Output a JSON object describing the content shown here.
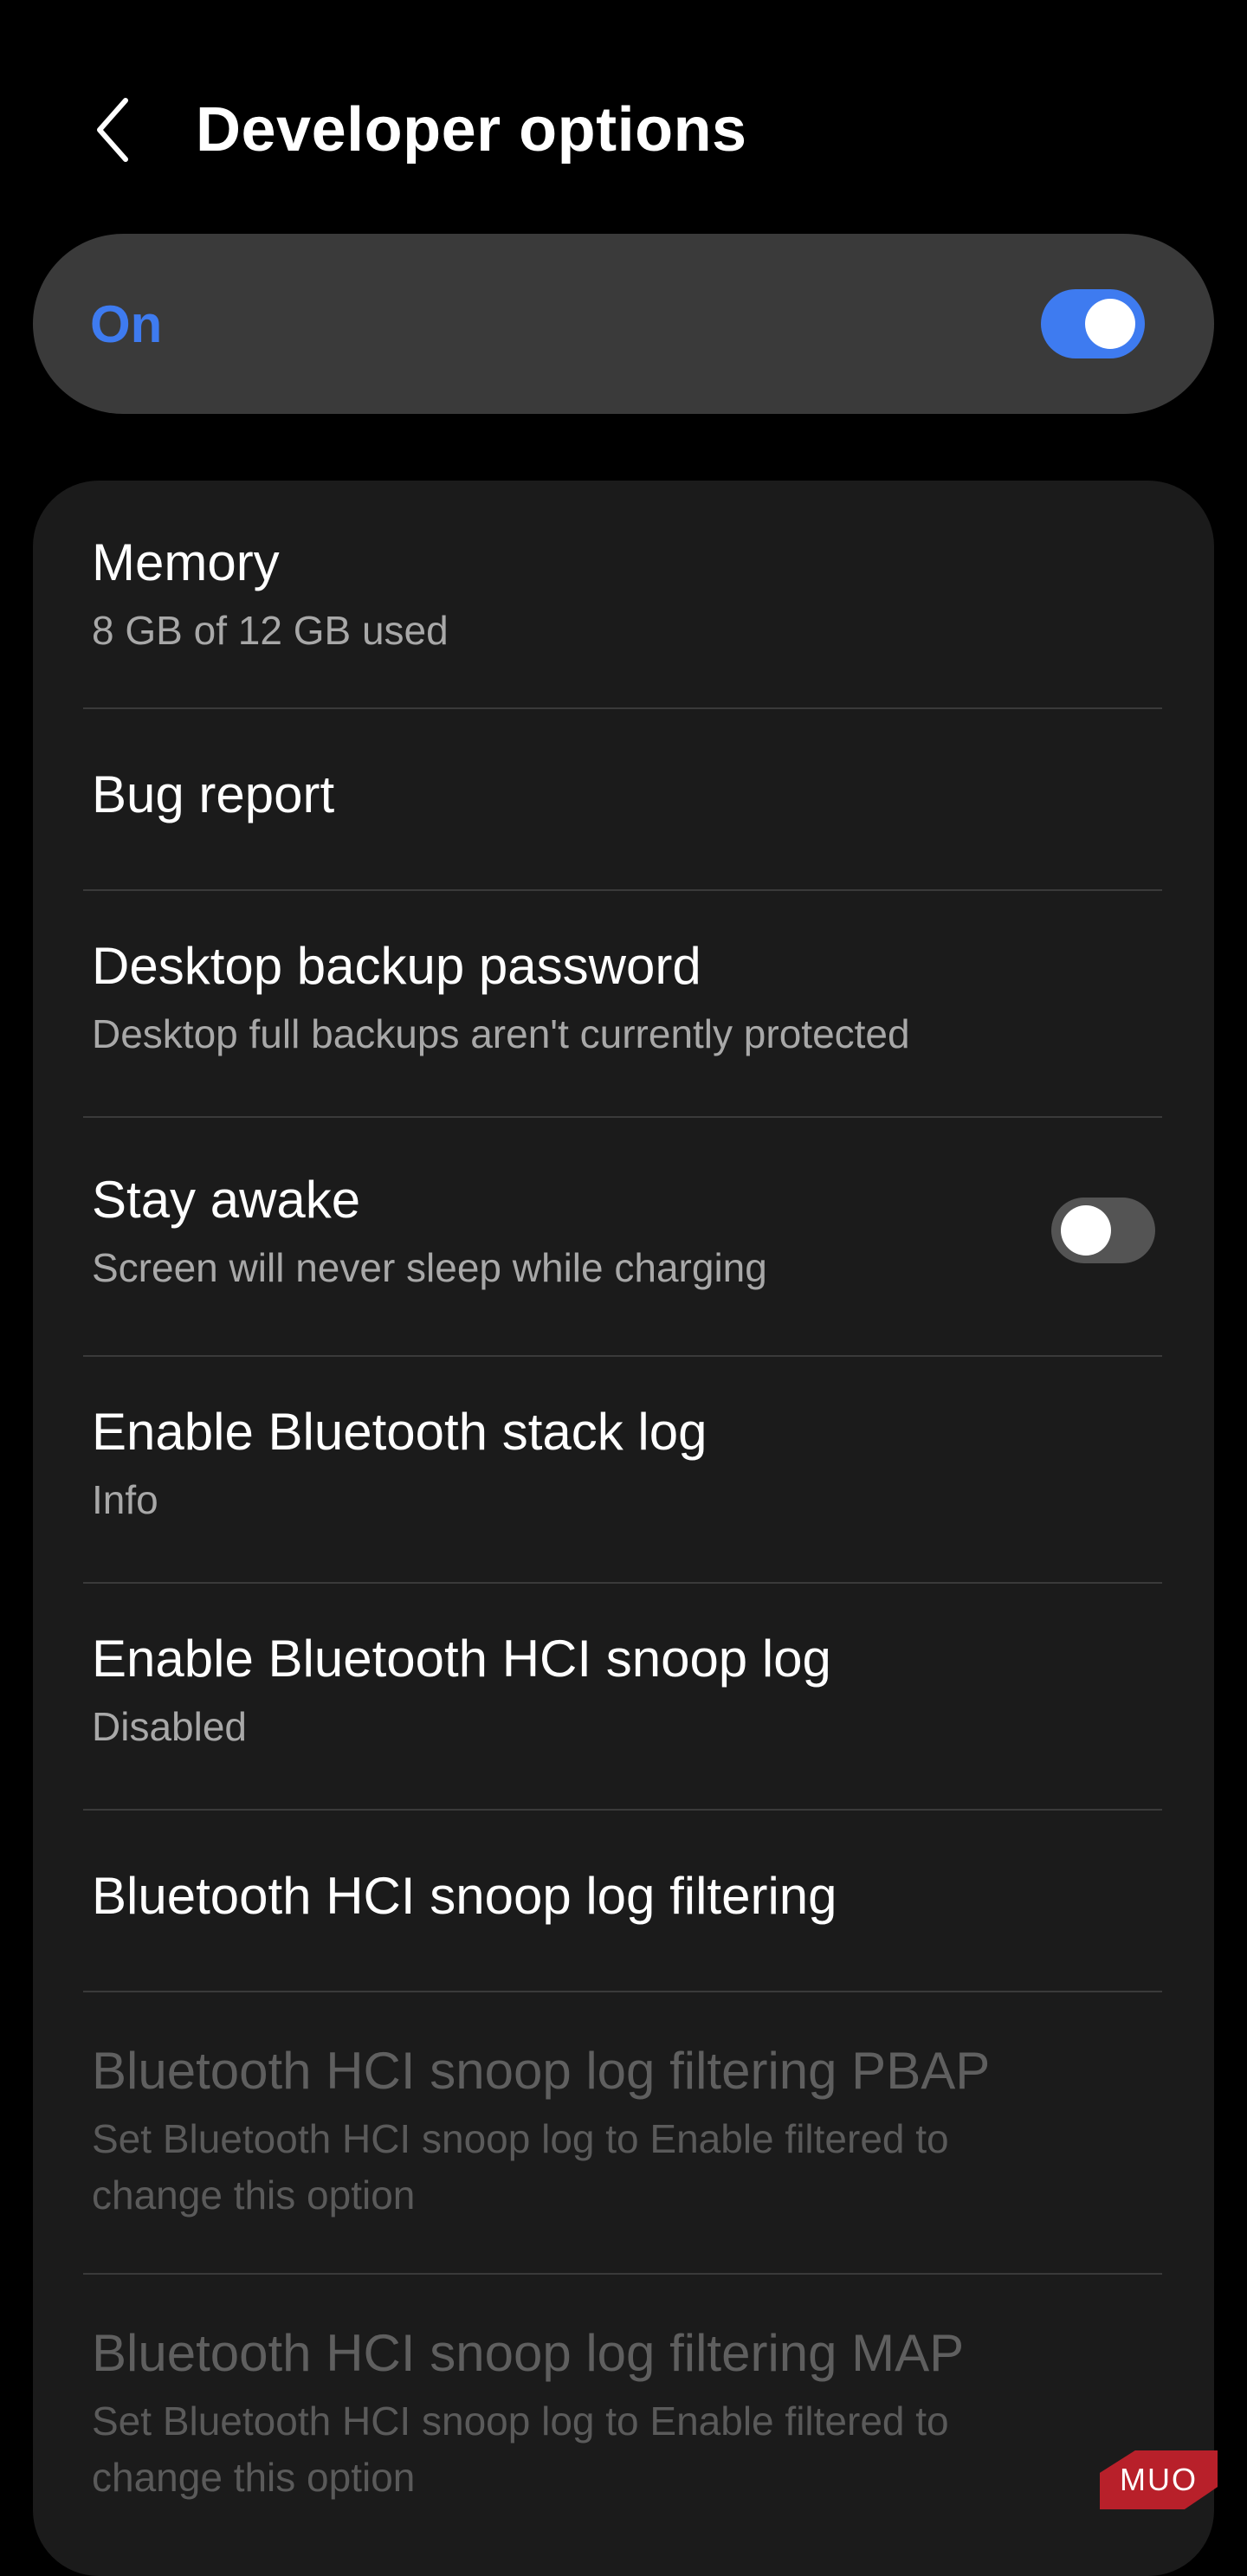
{
  "header": {
    "title": "Developer options",
    "back_icon": "chevron-left-icon"
  },
  "master_toggle": {
    "label": "On",
    "state": "on",
    "accent_color": "#3e7bf0"
  },
  "settings": [
    {
      "title": "Memory",
      "subtitle": "8 GB of 12 GB used",
      "enabled": true
    },
    {
      "title": "Bug report",
      "enabled": true
    },
    {
      "title": "Desktop backup password",
      "subtitle": "Desktop full backups aren't currently protected",
      "enabled": true
    },
    {
      "title": "Stay awake",
      "subtitle": "Screen will never sleep while charging",
      "enabled": true,
      "toggle": "off"
    },
    {
      "title": "Enable Bluetooth stack log",
      "subtitle": "Info",
      "enabled": true
    },
    {
      "title": "Enable Bluetooth HCI snoop log",
      "subtitle": "Disabled",
      "enabled": true
    },
    {
      "title": "Bluetooth HCI snoop log filtering",
      "enabled": true
    },
    {
      "title": "Bluetooth HCI snoop log filtering PBAP",
      "subtitle_line1": "Set Bluetooth HCI snoop log to Enable filtered to",
      "subtitle_line2": "change this option",
      "enabled": false
    },
    {
      "title": "Bluetooth HCI snoop log filtering MAP",
      "subtitle_line1": "Set Bluetooth HCI snoop log to Enable filtered to",
      "subtitle_line2": "change this option",
      "enabled": false
    }
  ],
  "watermark": {
    "text": "MUO",
    "color": "#b8202a"
  }
}
